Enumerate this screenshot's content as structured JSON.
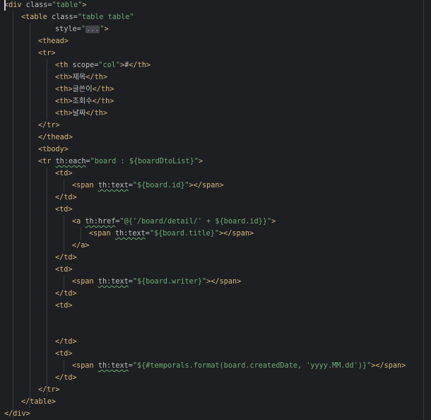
{
  "editor": {
    "lines": [
      {
        "indent": 0,
        "tokens": [
          [
            "tag",
            "<div"
          ],
          [
            "attr",
            " class="
          ],
          [
            "str",
            "\"table\""
          ],
          [
            "tag",
            ">"
          ]
        ]
      },
      {
        "indent": 1,
        "tokens": [
          [
            "tag",
            "<table"
          ],
          [
            "attr",
            " class="
          ],
          [
            "str",
            "\"table table\""
          ]
        ]
      },
      {
        "indent": 3,
        "tokens": [
          [
            "attr",
            "style="
          ],
          [
            "str",
            "\""
          ],
          [
            "fold",
            "..."
          ],
          [
            "str",
            "\""
          ],
          [
            "tag",
            ">"
          ]
        ]
      },
      {
        "indent": 2,
        "tokens": [
          [
            "tag",
            "<thead>"
          ]
        ]
      },
      {
        "indent": 2,
        "tokens": [
          [
            "tag",
            "<tr>"
          ]
        ]
      },
      {
        "indent": 3,
        "tokens": [
          [
            "tag",
            "<th"
          ],
          [
            "attr",
            " scope="
          ],
          [
            "str",
            "\"col\""
          ],
          [
            "tag",
            ">"
          ],
          [
            "txt",
            "#"
          ],
          [
            "tag",
            "</th>"
          ]
        ]
      },
      {
        "indent": 3,
        "tokens": [
          [
            "tag",
            "<th>"
          ],
          [
            "txt",
            "제목"
          ],
          [
            "tag",
            "</th>"
          ]
        ]
      },
      {
        "indent": 3,
        "tokens": [
          [
            "tag",
            "<th>"
          ],
          [
            "txt",
            "글쓴이"
          ],
          [
            "tag",
            "</th>"
          ]
        ]
      },
      {
        "indent": 3,
        "tokens": [
          [
            "tag",
            "<th>"
          ],
          [
            "txt",
            "조회수"
          ],
          [
            "tag",
            "</th>"
          ]
        ]
      },
      {
        "indent": 3,
        "tokens": [
          [
            "tag",
            "<th>"
          ],
          [
            "txt",
            "날짜"
          ],
          [
            "tag",
            "</th>"
          ]
        ]
      },
      {
        "indent": 2,
        "tokens": [
          [
            "tag",
            "</tr>"
          ]
        ]
      },
      {
        "indent": 2,
        "tokens": [
          [
            "tag",
            "</thead>"
          ]
        ]
      },
      {
        "indent": 2,
        "tokens": [
          [
            "tag",
            "<tbody>"
          ]
        ]
      },
      {
        "indent": 2,
        "tokens": [
          [
            "tag",
            "<tr"
          ],
          [
            "txt",
            " "
          ],
          [
            "thattr",
            "th:each"
          ],
          [
            "attr",
            "="
          ],
          [
            "str",
            "\"board : ${boardDtoList}\""
          ],
          [
            "tag",
            ">"
          ]
        ]
      },
      {
        "indent": 3,
        "tokens": [
          [
            "tag",
            "<td>"
          ]
        ]
      },
      {
        "indent": 4,
        "tokens": [
          [
            "tag",
            "<span"
          ],
          [
            "txt",
            " "
          ],
          [
            "thattr",
            "th:text"
          ],
          [
            "attr",
            "="
          ],
          [
            "str",
            "\"${board.id}\""
          ],
          [
            "tag",
            "></span>"
          ]
        ]
      },
      {
        "indent": 3,
        "tokens": [
          [
            "tag",
            "</td>"
          ]
        ]
      },
      {
        "indent": 3,
        "tokens": [
          [
            "tag",
            "<td>"
          ]
        ]
      },
      {
        "indent": 4,
        "tokens": [
          [
            "tag",
            "<a"
          ],
          [
            "txt",
            " "
          ],
          [
            "thattr",
            "th:href"
          ],
          [
            "attr",
            "="
          ],
          [
            "str",
            "\"@{'/board/detail/' + ${board.id}}\""
          ],
          [
            "tag",
            ">"
          ]
        ]
      },
      {
        "indent": 5,
        "tokens": [
          [
            "tag",
            "<span"
          ],
          [
            "txt",
            " "
          ],
          [
            "thattr",
            "th:text"
          ],
          [
            "attr",
            "="
          ],
          [
            "str",
            "\"${board.title}\""
          ],
          [
            "tag",
            "></span>"
          ]
        ]
      },
      {
        "indent": 4,
        "tokens": [
          [
            "tag",
            "</a>"
          ]
        ]
      },
      {
        "indent": 3,
        "tokens": [
          [
            "tag",
            "</td>"
          ]
        ]
      },
      {
        "indent": 3,
        "tokens": [
          [
            "tag",
            "<td>"
          ]
        ]
      },
      {
        "indent": 4,
        "tokens": [
          [
            "tag",
            "<span"
          ],
          [
            "txt",
            " "
          ],
          [
            "thattr",
            "th:text"
          ],
          [
            "attr",
            "="
          ],
          [
            "str",
            "\"${board.writer}\""
          ],
          [
            "tag",
            "></span>"
          ]
        ]
      },
      {
        "indent": 3,
        "tokens": [
          [
            "tag",
            "</td>"
          ]
        ]
      },
      {
        "indent": 3,
        "tokens": [
          [
            "tag",
            "<td>"
          ]
        ]
      },
      {
        "indent": 0,
        "tokens": []
      },
      {
        "indent": 0,
        "tokens": []
      },
      {
        "indent": 3,
        "tokens": [
          [
            "tag",
            "</td>"
          ]
        ]
      },
      {
        "indent": 3,
        "tokens": [
          [
            "tag",
            "<td>"
          ]
        ]
      },
      {
        "indent": 4,
        "tokens": [
          [
            "tag",
            "<span"
          ],
          [
            "txt",
            " "
          ],
          [
            "thattr",
            "th:text"
          ],
          [
            "attr",
            "="
          ],
          [
            "str",
            "\"${#temporals.format(board.createdDate, 'yyyy.MM.dd')}\""
          ],
          [
            "tag",
            "></span>"
          ]
        ]
      },
      {
        "indent": 3,
        "tokens": [
          [
            "tag",
            "</td>"
          ]
        ]
      },
      {
        "indent": 2,
        "tokens": [
          [
            "tag",
            "</tr>"
          ]
        ]
      },
      {
        "indent": 1,
        "tokens": [
          [
            "tag",
            "</table>"
          ]
        ]
      },
      {
        "indent": 0,
        "tokens": [
          [
            "tag",
            "</div>"
          ]
        ]
      }
    ],
    "colors": {
      "background": "#1e1f22",
      "tag": "#d5b778",
      "string": "#6aab73",
      "text": "#bcbec4"
    }
  }
}
